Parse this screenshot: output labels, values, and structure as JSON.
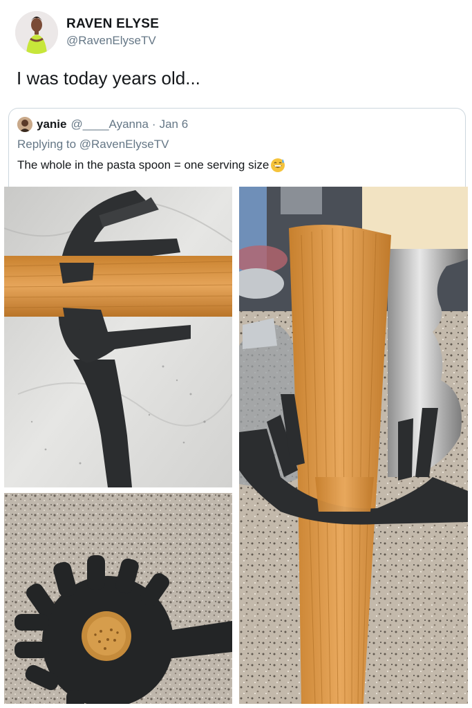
{
  "tweet": {
    "author_name": "RAVEN ELYSE",
    "author_handle": "@RavenElyseTV",
    "text": "I was today years old..."
  },
  "quoted_tweet": {
    "author_name": "yanie",
    "author_handle": "@____Ayanna",
    "separator": "·",
    "date": "Jan 6",
    "replying_to": "Replying to @RavenElyseTV",
    "text": "The whole in the pasta spoon = one serving size",
    "emoji": "grinning-sweat-emoji"
  },
  "media": {
    "photos": [
      "pasta-spoon-holding-spaghetti",
      "pasta-spoon-top-view",
      "spaghetti-through-spoon-hole"
    ]
  },
  "colors": {
    "text": "#14171a",
    "secondary": "#657786",
    "border": "#ccd6dd",
    "spaghetti": "#d99a4a",
    "spoon": "#2b2d2f"
  }
}
